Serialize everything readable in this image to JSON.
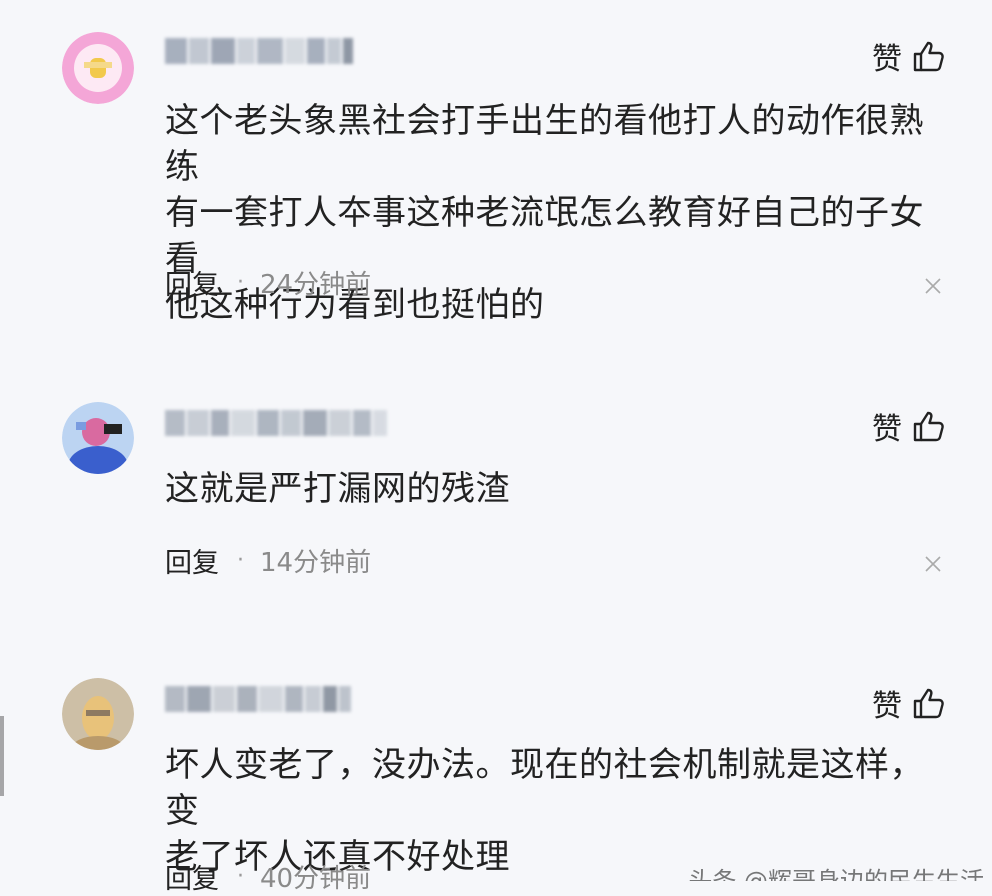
{
  "comments": [
    {
      "like_label": "赞",
      "text": "这个老头象黑社会打手出生的看他打人的动作很熟练有一套打人本事这种老流氓怎么教育好自己的子女看他这种行为看到也挺怕的",
      "lines": [
        "这个老头象黑社会打手出生的看他打人的动作很熟练",
        "有一套打人夲事这种老流氓怎么教育好自己的子女看",
        "他这种行为看到也挺怕的"
      ],
      "reply_label": "回复",
      "separator": "·",
      "time": "24分钟前",
      "close_icon": "close-icon",
      "avatar_colors": [
        "#f4a6d7",
        "#ffffff",
        "#f2c94c"
      ]
    },
    {
      "like_label": "赞",
      "lines": [
        "这就是严打漏网的残渣"
      ],
      "reply_label": "回复",
      "separator": "·",
      "time": "14分钟前",
      "close_icon": "close-icon",
      "avatar_colors": [
        "#a8c6f0",
        "#3a5fcd",
        "#d96aa0"
      ]
    },
    {
      "like_label": "赞",
      "lines": [
        "坏人变老了，没办法。现在的社会机制就是这样，变",
        "老了坏人还真不好处理"
      ],
      "reply_label": "回复",
      "separator": "·",
      "time": "40分钟前",
      "close_icon": "close-icon",
      "avatar_colors": [
        "#c9b79c",
        "#e8c27a",
        "#8d7a62"
      ]
    }
  ],
  "watermark": "头条 @辉哥身边的民生生活",
  "icons": {
    "like": "thumbs-up-icon",
    "close": "close-icon"
  },
  "colors": {
    "background": "#f6f7fa",
    "text": "#222222",
    "time": "#8a8a8a"
  }
}
